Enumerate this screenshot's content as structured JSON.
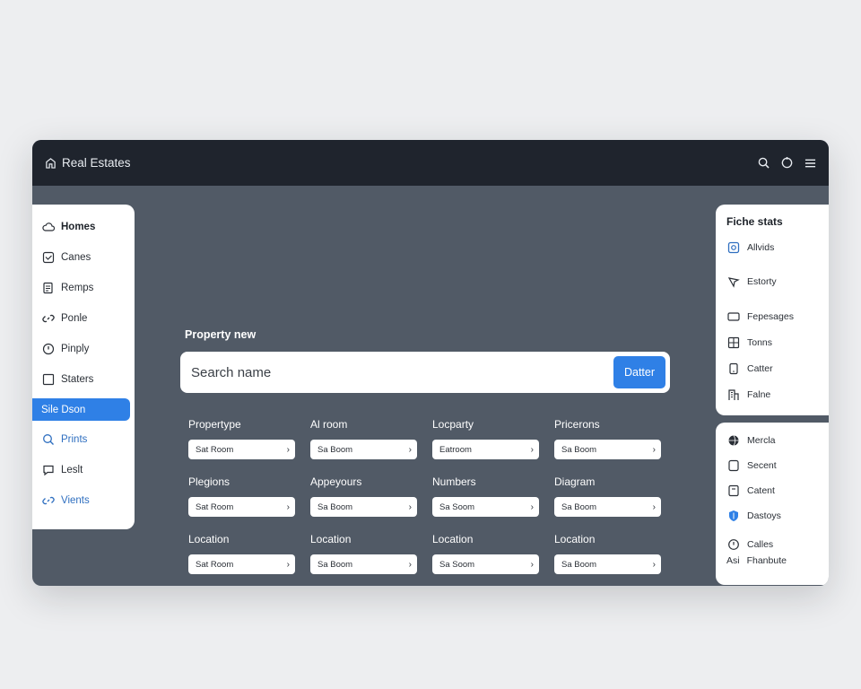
{
  "app": {
    "title": "Real Estates"
  },
  "sidebar": {
    "items": [
      {
        "label": "Homes",
        "icon": "cloud-icon"
      },
      {
        "label": "Canes",
        "icon": "checkbox-heart-icon"
      },
      {
        "label": "Remps",
        "icon": "document-icon"
      },
      {
        "label": "Ponle",
        "icon": "link-icon"
      },
      {
        "label": "Pinply",
        "icon": "camera-icon"
      },
      {
        "label": "Staters",
        "icon": "square-icon"
      },
      {
        "label": "Sile Dson",
        "icon": "none"
      },
      {
        "label": "Prints",
        "icon": "search-icon"
      },
      {
        "label": "Leslt",
        "icon": "chat-icon"
      },
      {
        "label": "Vients",
        "icon": "link-icon"
      }
    ]
  },
  "main": {
    "section_title": "Property new",
    "search": {
      "placeholder": "Search name",
      "button_label": "Datter"
    },
    "filters": [
      {
        "label": "Propertype",
        "value": "Sat Room"
      },
      {
        "label": "Al room",
        "value": "Sa Boom"
      },
      {
        "label": "Locparty",
        "value": "Eatroom"
      },
      {
        "label": "Pricerons",
        "value": "Sa Boom"
      },
      {
        "label": "Plegions",
        "value": "Sat Room"
      },
      {
        "label": "Appeyours",
        "value": "Sa Boom"
      },
      {
        "label": "Numbers",
        "value": "Sa Soom"
      },
      {
        "label": "Diagram",
        "value": "Sa Boom"
      },
      {
        "label": "Location",
        "value": "Sat Room"
      },
      {
        "label": "Location",
        "value": "Sa Boom"
      },
      {
        "label": "Location",
        "value": "Sa Soom"
      },
      {
        "label": "Location",
        "value": "Sa Boom"
      }
    ]
  },
  "right_panel": {
    "title": "Fiche stats",
    "items": [
      {
        "label": "Allvids",
        "icon": "camera-square-icon"
      },
      {
        "label": "Estorty",
        "icon": "pin-icon"
      },
      {
        "label": "Fepesages",
        "icon": "card-icon"
      },
      {
        "label": "Tonns",
        "icon": "grid-icon"
      },
      {
        "label": "Catter",
        "icon": "phone-icon"
      },
      {
        "label": "Falne",
        "icon": "building-icon"
      }
    ],
    "secondary": [
      {
        "label": "Mercla",
        "icon": "globe-icon"
      },
      {
        "label": "Secent",
        "icon": "square-icon"
      },
      {
        "label": "Catent",
        "icon": "box-icon"
      },
      {
        "label": "Dastoys",
        "icon": "shield-icon"
      },
      {
        "label": "Calles",
        "icon": "clock-icon"
      }
    ],
    "footer": {
      "prefix": "Asi",
      "label": "Fhanbute"
    }
  },
  "colors": {
    "accent": "#2f80e6",
    "topbar": "#1f242d",
    "canvas": "#515a66",
    "background": "#edeef0"
  }
}
